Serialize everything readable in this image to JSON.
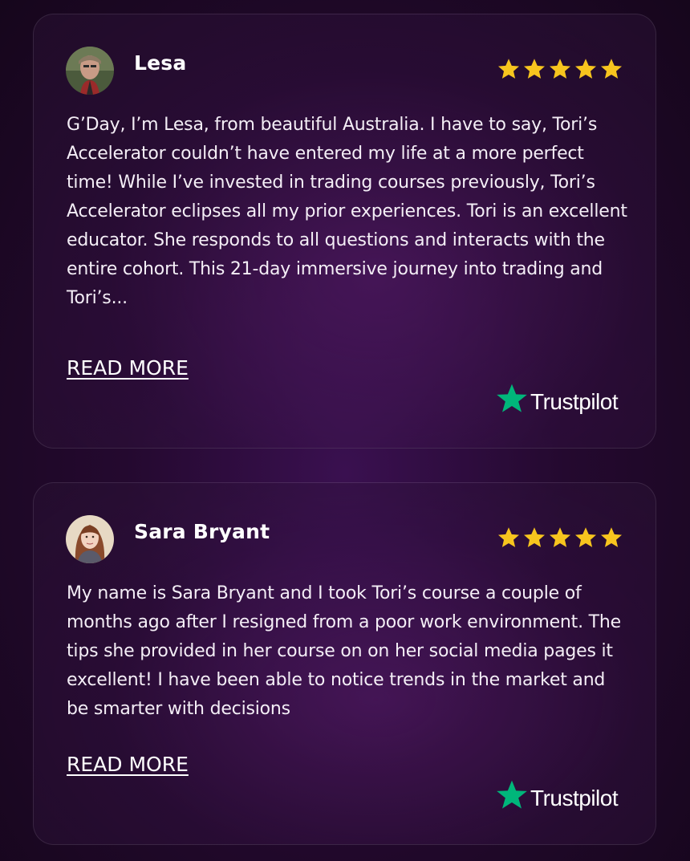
{
  "colors": {
    "star": "#f7c51e",
    "trustpilot_green": "#00b67a",
    "text": "#ffffff"
  },
  "reviews": [
    {
      "name": "Lesa",
      "rating": 5,
      "avatar_icon": "avatar-photo",
      "text": "G’Day, I’m Lesa, from beautiful Australia. I have to say, Tori’s Accelerator couldn’t have entered my life at a more perfect time! While I’ve invested in trading courses previously, Tori’s Accelerator eclipses all my prior experiences. Tori is an excellent educator. She responds to all questions and interacts with the entire cohort. This 21-day immersive journey into trading and Tori’s...",
      "read_more": "READ MORE",
      "source": "Trustpilot"
    },
    {
      "name": "Sara Bryant",
      "rating": 5,
      "avatar_icon": "avatar-photo",
      "text": "My name is Sara Bryant and I took Tori’s course a couple of months ago after I resigned from a poor work environment. The tips she provided in her course on on her social media pages it excellent! I have been able to notice trends in the market and be smarter with decisions",
      "read_more": "READ MORE",
      "source": "Trustpilot"
    }
  ]
}
